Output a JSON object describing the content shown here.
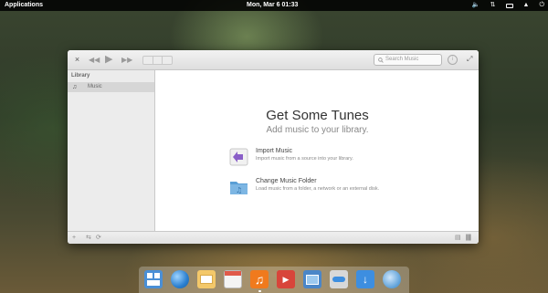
{
  "panel": {
    "applications": "Applications",
    "clock": "Mon, Mar 6  01:33",
    "tray": [
      "volume-icon",
      "network-icon",
      "battery-icon",
      "notifications-icon",
      "power-icon"
    ]
  },
  "window": {
    "toolbar": {
      "close_icon": "close-icon",
      "previous_icon": "previous-icon",
      "play_icon": "play-icon",
      "next_icon": "next-icon",
      "view_modes": [
        "grid-view",
        "list-view",
        "column-view"
      ],
      "search_placeholder": "Search Music"
    },
    "sidebar": {
      "section": "Library",
      "items": [
        {
          "label": "Music",
          "icon": "music-note-icon",
          "selected": true
        }
      ]
    },
    "welcome": {
      "title": "Get Some Tunes",
      "subtitle": "Add music to your library.",
      "actions": [
        {
          "title": "Import Music",
          "description": "Import music from a source into your library.",
          "icon": "import-arrow-icon"
        },
        {
          "title": "Change Music Folder",
          "description": "Load music from a folder, a network or an external disk.",
          "icon": "folder-music-icon"
        }
      ]
    },
    "statusbar": [
      "add-icon",
      "shuffle-icon",
      "repeat-icon",
      "visualizer-icon",
      "equalizer-icon"
    ]
  },
  "dock": {
    "apps": [
      "multitasking-view",
      "web-browser",
      "mail",
      "calendar",
      "music",
      "videos",
      "photos",
      "system-settings",
      "appcenter",
      "network-app"
    ],
    "colors": {
      "music_accent": "#f07a1d",
      "accent_blue": "#3d8ee0"
    }
  }
}
